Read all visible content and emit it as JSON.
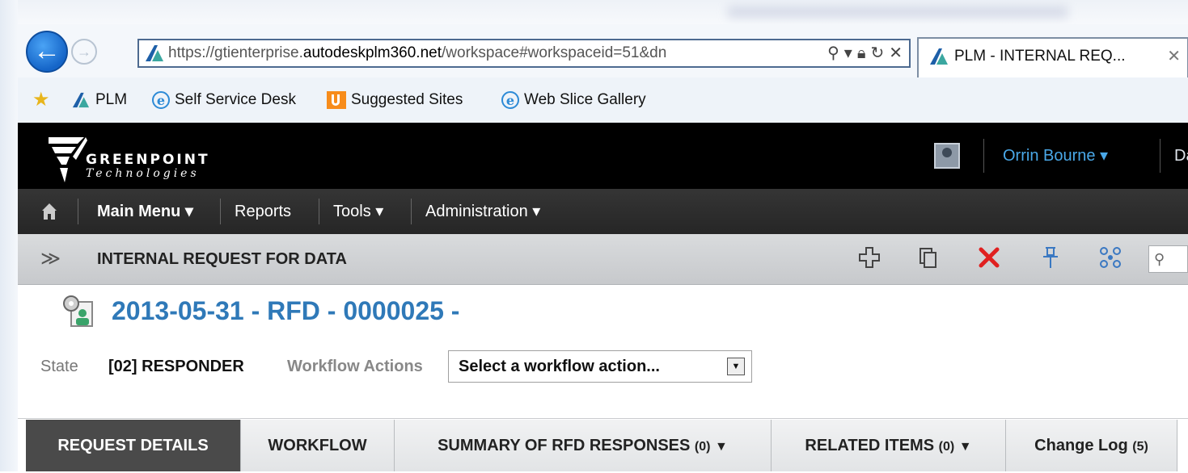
{
  "browser": {
    "url_prefix": "https://gtienterprise.",
    "url_domain": "autodeskplm360.net",
    "url_suffix": "/workspace#workspaceid=51&dn",
    "tab_title": "PLM - INTERNAL REQ...",
    "url_controls": [
      "search-icon",
      "dropdown-icon",
      "lock-icon",
      "refresh-icon",
      "stop-icon"
    ]
  },
  "favorites": {
    "items": [
      {
        "label": "PLM",
        "icon": "autodesk-icon"
      },
      {
        "label": "Self Service Desk",
        "icon": "ie-icon"
      },
      {
        "label": "Suggested Sites",
        "icon": "bing-icon"
      },
      {
        "label": "Web Slice Gallery",
        "icon": "ie-icon"
      }
    ]
  },
  "header": {
    "logo_word": "GREENPOINT",
    "logo_sub": "Technologies",
    "user_name": "Orrin Bourne ▾",
    "dashboard_fragment": "Das"
  },
  "menu": {
    "main_menu": "Main Menu ▾",
    "reports": "Reports",
    "tools": "Tools ▾",
    "administration": "Administration ▾"
  },
  "workspace": {
    "title": "INTERNAL REQUEST FOR DATA",
    "toolbar_icons": [
      "add-icon",
      "copy-icon",
      "delete-icon",
      "pin-icon",
      "network-icon",
      "search-icon"
    ]
  },
  "item": {
    "title": "2013-05-31 - RFD - 0000025 -",
    "state_label": "State",
    "state_value": "[02] RESPONDER",
    "workflow_label": "Workflow Actions",
    "workflow_placeholder": "Select a workflow action..."
  },
  "tabs": [
    {
      "label": "REQUEST DETAILS",
      "count": "",
      "dropdown": false,
      "active": true
    },
    {
      "label": "WORKFLOW",
      "count": "",
      "dropdown": false,
      "active": false
    },
    {
      "label": "SUMMARY OF RFD RESPONSES",
      "count": "(0)",
      "dropdown": true,
      "active": false
    },
    {
      "label": "RELATED ITEMS",
      "count": "(0)",
      "dropdown": true,
      "active": false
    },
    {
      "label": "Change Log",
      "count": "(5)",
      "dropdown": false,
      "active": false
    }
  ],
  "colors": {
    "link_blue": "#2f79b8",
    "user_blue": "#4aa8e8",
    "delete_red": "#e02020",
    "toolbar_blue": "#3a78c2"
  }
}
